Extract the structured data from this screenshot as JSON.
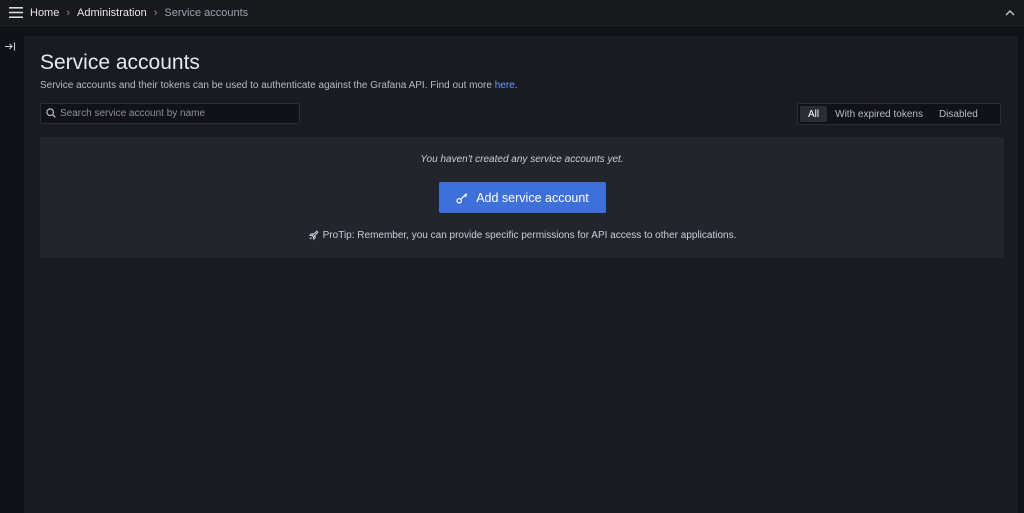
{
  "topbar": {
    "breadcrumbs": [
      {
        "label": "Home"
      },
      {
        "label": "Administration"
      },
      {
        "label": "Service accounts"
      }
    ]
  },
  "page": {
    "title": "Service accounts",
    "description_prefix": "Service accounts and their tokens can be used to authenticate against the Grafana API. Find out more ",
    "description_link": "here",
    "description_suffix": "."
  },
  "search": {
    "placeholder": "Search service account by name",
    "value": ""
  },
  "filters": {
    "options": [
      {
        "label": "All",
        "active": true
      },
      {
        "label": "With expired tokens",
        "active": false
      },
      {
        "label": "Disabled",
        "active": false
      }
    ]
  },
  "empty_state": {
    "message": "You haven't created any service accounts yet.",
    "button_label": "Add service account",
    "protip": "ProTip: Remember, you can provide specific permissions for API access to other applications."
  },
  "colors": {
    "primary_button": "#3d71d9",
    "link": "#6e9fff",
    "page_bg": "#181b1f",
    "panel_bg": "#22252b"
  },
  "icons": {
    "menu": "hamburger-icon",
    "chevron": "chevron-right-icon",
    "collapse": "chevron-up-icon",
    "dock": "dock-menu-icon",
    "search": "search-icon",
    "key": "key-icon",
    "rocket": "rocket-icon"
  }
}
